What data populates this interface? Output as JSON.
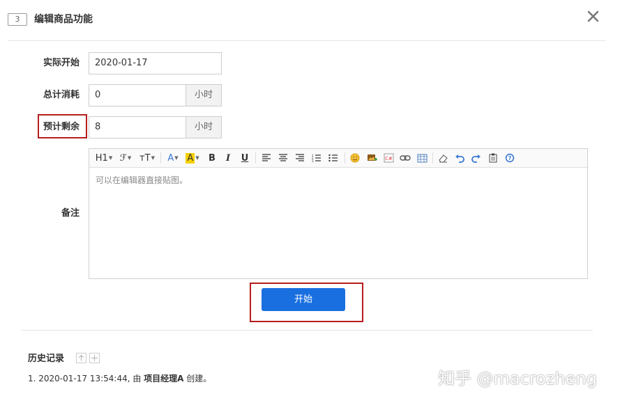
{
  "dialog": {
    "task_id": "3",
    "title": "编辑商品功能"
  },
  "form": {
    "actual_start": {
      "label": "实际开始",
      "value": "2020-01-17"
    },
    "total_consumed": {
      "label": "总计消耗",
      "value": "0",
      "unit": "小时"
    },
    "estimated_left": {
      "label": "预计剩余",
      "value": "8",
      "unit": "小时"
    },
    "remark": {
      "label": "备注",
      "placeholder": "可以在编辑器直接贴图。"
    }
  },
  "toolbar": {
    "heading": "H1",
    "font": "ℱ",
    "size": "тT",
    "font_color": "A",
    "bg_color": "A",
    "bold": "B",
    "italic": "I",
    "underline": "U"
  },
  "actions": {
    "start_label": "开始"
  },
  "history": {
    "title": "历史记录",
    "entry_prefix": "1. 2020-01-17 13:54:44, 由 ",
    "entry_actor": "项目经理A",
    "entry_suffix": " 创建。"
  },
  "watermark": "知乎 @macrozheng",
  "colors": {
    "primary": "#1a6fe0",
    "highlight": "#b71c1c"
  }
}
